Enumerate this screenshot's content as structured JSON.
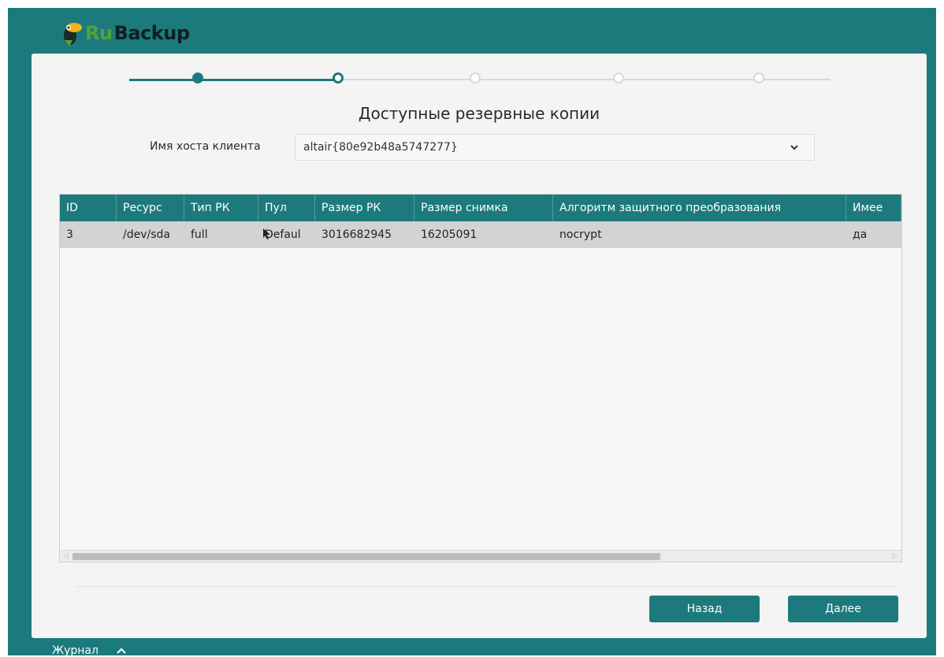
{
  "app": {
    "brand_ru": "Ru",
    "brand_backup": "Backup",
    "colors": {
      "accent": "#1d7a7c",
      "brand_green": "#4ea43a",
      "row_selected": "#d3d3d3"
    }
  },
  "wizard": {
    "steps_total": 5,
    "current_step": 2,
    "title": "Доступные резервные копии",
    "host_label": "Имя хоста клиента",
    "host_value": "altair{80e92b48a5747277}"
  },
  "table": {
    "columns": [
      "ID",
      "Ресурс",
      "Тип РК",
      "Пул",
      "Размер РК",
      "Размер снимка",
      "Алгоритм защитного преобразования",
      "Имее"
    ],
    "rows": [
      [
        "3",
        "/dev/sda",
        "full",
        "Defaul",
        "3016682945",
        "16205091",
        "nocrypt",
        "да"
      ]
    ],
    "hscroll_fraction": 0.72
  },
  "buttons": {
    "back": "Назад",
    "next": "Далее"
  },
  "footer": {
    "log_label": "Журнал"
  }
}
